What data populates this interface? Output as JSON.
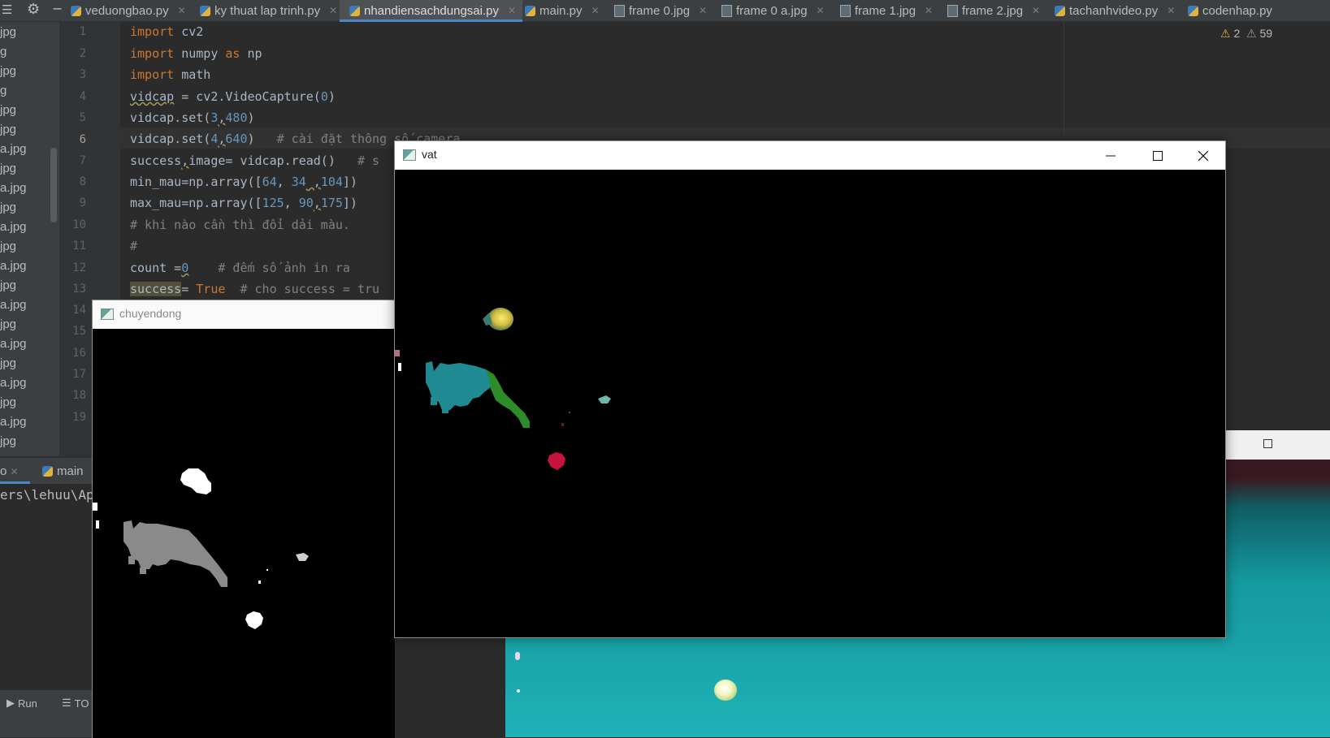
{
  "tabs": [
    {
      "label": "veduongbao.py",
      "type": "py"
    },
    {
      "label": "ky thuat lap trinh.py",
      "type": "py"
    },
    {
      "label": "nhandiensachdungsai.py",
      "type": "py",
      "active": true
    },
    {
      "label": "main.py",
      "type": "py"
    },
    {
      "label": "frame 0.jpg",
      "type": "jpg"
    },
    {
      "label": "frame 0 a.jpg",
      "type": "jpg"
    },
    {
      "label": "frame 1.jpg",
      "type": "jpg"
    },
    {
      "label": "frame 2.jpg",
      "type": "jpg"
    },
    {
      "label": "tachanhvideo.py",
      "type": "py"
    },
    {
      "label": "codenhap.py",
      "type": "py"
    }
  ],
  "project_files": [
    "jpg",
    "g",
    "jpg",
    "g",
    "jpg",
    "jpg",
    "a.jpg",
    "jpg",
    "a.jpg",
    "jpg",
    "a.jpg",
    "jpg",
    "a.jpg",
    "jpg",
    "a.jpg",
    "jpg",
    "a.jpg",
    "jpg",
    "a.jpg",
    "jpg",
    "a.jpg",
    "jpg"
  ],
  "line_numbers": [
    "1",
    "2",
    "3",
    "4",
    "5",
    "6",
    "7",
    "8",
    "9",
    "10",
    "11",
    "12",
    "13",
    "14",
    "15",
    "16",
    "17",
    "18",
    "19"
  ],
  "current_line": "6",
  "code": {
    "l1_kw": "import",
    "l1_rest": " cv2",
    "l2_kw": "import",
    "l2_mid": " numpy ",
    "l2_as": "as",
    "l2_rest": " np",
    "l3_kw": "import",
    "l3_rest": " math",
    "l4_var": "vidcap",
    "l4_a": " = cv2.VideoCapture(",
    "l4_n": "0",
    "l4_b": ")",
    "l5_a": "vidcap.set(",
    "l5_n1": "3",
    "l5_c": ",",
    "l5_n2": "480",
    "l5_b": ")",
    "l6_a": "vidcap.set(",
    "l6_n1": "4",
    "l6_c": ",",
    "l6_n2": "640",
    "l6_b": ")",
    "l6_cm": "   # cài đặt thông số camera",
    "l7_a": "success",
    "l7_c": ",",
    "l7_b": "image= vidcap.read()",
    "l7_cm": "   # s",
    "l8_a": "min_mau=np.array([",
    "l8_n1": "64",
    "l8_s1": ", ",
    "l8_n2": "34",
    "l8_s2": " ,",
    "l8_n3": "104",
    "l8_b": "])",
    "l9_a": "max_mau=np.array([",
    "l9_n1": "125",
    "l9_s1": ", ",
    "l9_n2": "90",
    "l9_s2": ",",
    "l9_n3": "175",
    "l9_b": "])",
    "l10_cm": "# khi nào cần thì đổi dải màu.",
    "l11_cm": "#",
    "l12_a": "count =",
    "l12_n": "0",
    "l12_cm": "    # đếm số ảnh in ra",
    "l13_var": "success",
    "l13_a": "= ",
    "l13_kw": "True",
    "l13_cm": "  # cho success = tru"
  },
  "warnings": {
    "count1": "2",
    "count2": "59"
  },
  "run_tabs": {
    "prev": "o",
    "main": "main"
  },
  "console_path": "ers\\lehuu\\Ap",
  "bottom_buttons": {
    "run": "Run",
    "todo": "TO"
  },
  "windows": {
    "chuyendong": {
      "title": "chuyendong"
    },
    "vat": {
      "title": "vat"
    }
  },
  "icons": {
    "minimize": "minimize-icon",
    "maximize": "maximize-icon",
    "close": "close-icon"
  },
  "colors": {
    "ide_bg": "#2b2b2b",
    "keyword": "#cc7832",
    "number": "#6897bb",
    "comment": "#808080",
    "table_teal": "#1fb2b8"
  }
}
